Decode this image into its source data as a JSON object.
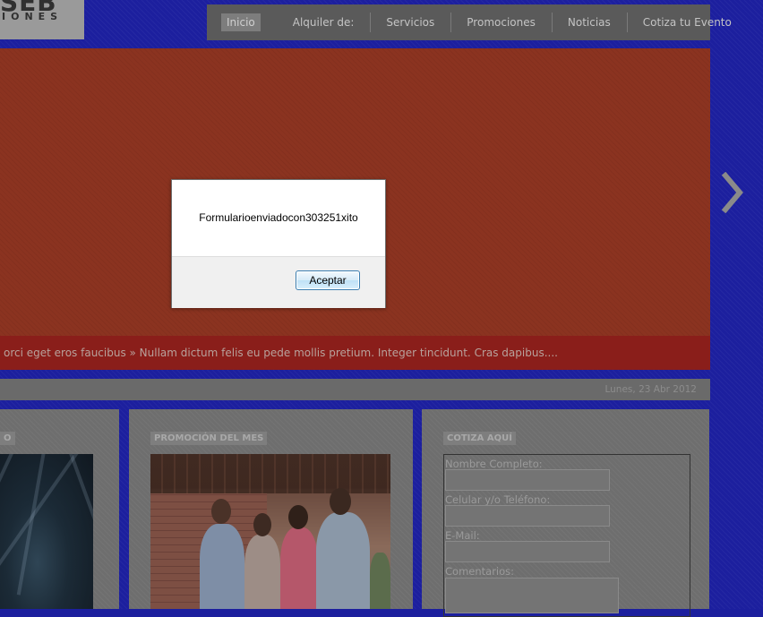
{
  "logo": {
    "wordmark": "SEB",
    "tagline": "IONES"
  },
  "nav": {
    "items": [
      {
        "label": "Inicio",
        "active": true
      },
      {
        "label": "Alquiler de:"
      },
      {
        "label": "Servicios"
      },
      {
        "label": "Promociones"
      },
      {
        "label": "Noticias"
      },
      {
        "label": "Cotiza tu Evento"
      }
    ]
  },
  "slider": {
    "ticker": "orci eget eros faucibus » Nullam dictum felis eu pede mollis pretium. Integer tincidunt. Cras dapibus....",
    "next_icon": "chevron-right-icon"
  },
  "date": "Lunes, 23 Abr 2012",
  "panels": {
    "left": {
      "title": "O"
    },
    "promo": {
      "title": "PROMOCIÓN DEL MES"
    },
    "quote": {
      "title": "COTIZA AQUÍ",
      "fields": {
        "name": "Nombre Completo:",
        "phone": "Celular y/o Teléfono:",
        "email": "E-Mail:",
        "comments": "Comentarios:"
      }
    }
  },
  "dialog": {
    "message": "Formularioenviadocon303251xito",
    "ok_label": "Aceptar"
  },
  "colors": {
    "background": "#1c1f9e",
    "slider": "#8b3320",
    "ticker": "#8a1e1a",
    "dialog_button_border": "#3c7fb1"
  }
}
